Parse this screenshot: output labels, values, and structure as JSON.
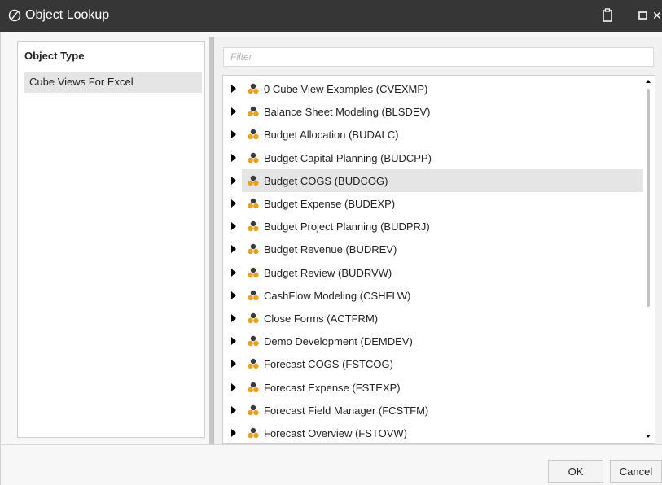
{
  "window": {
    "title": "Object Lookup"
  },
  "object_type": {
    "header": "Object Type",
    "items": [
      {
        "label": "Cube Views For Excel",
        "selected": true
      }
    ]
  },
  "filter": {
    "placeholder": "Filter",
    "value": ""
  },
  "tree": {
    "selected_index": 4,
    "items": [
      {
        "label": "0 Cube View Examples (CVEXMP)"
      },
      {
        "label": "Balance Sheet Modeling (BLSDEV)"
      },
      {
        "label": "Budget Allocation (BUDALC)"
      },
      {
        "label": "Budget Capital Planning (BUDCPP)"
      },
      {
        "label": "Budget COGS (BUDCOG)"
      },
      {
        "label": "Budget Expense (BUDEXP)"
      },
      {
        "label": "Budget Project Planning (BUDPRJ)"
      },
      {
        "label": "Budget Revenue (BUDREV)"
      },
      {
        "label": "Budget Review (BUDRVW)"
      },
      {
        "label": "CashFlow Modeling (CSHFLW)"
      },
      {
        "label": "Close Forms (ACTFRM)"
      },
      {
        "label": "Demo Development (DEMDEV)"
      },
      {
        "label": "Forecast COGS (FSTCOG)"
      },
      {
        "label": "Forecast Expense (FSTEXP)"
      },
      {
        "label": "Forecast Field Manager (FCSTFM)"
      },
      {
        "label": "Forecast Overview (FSTOVW)"
      }
    ]
  },
  "buttons": {
    "ok": "OK",
    "cancel": "Cancel"
  },
  "colors": {
    "titlebar": "#363636",
    "selection": "#e5e5e5",
    "cube_orange": "#e8a21d",
    "cube_dark": "#3a3a3a"
  },
  "icons": {
    "app": "openplace-logo-icon",
    "clipboard": "clipboard-icon",
    "maximize": "maximize-icon",
    "close": "close-icon",
    "expander": "expand-arrow-icon",
    "cube": "cube-view-group-icon"
  }
}
